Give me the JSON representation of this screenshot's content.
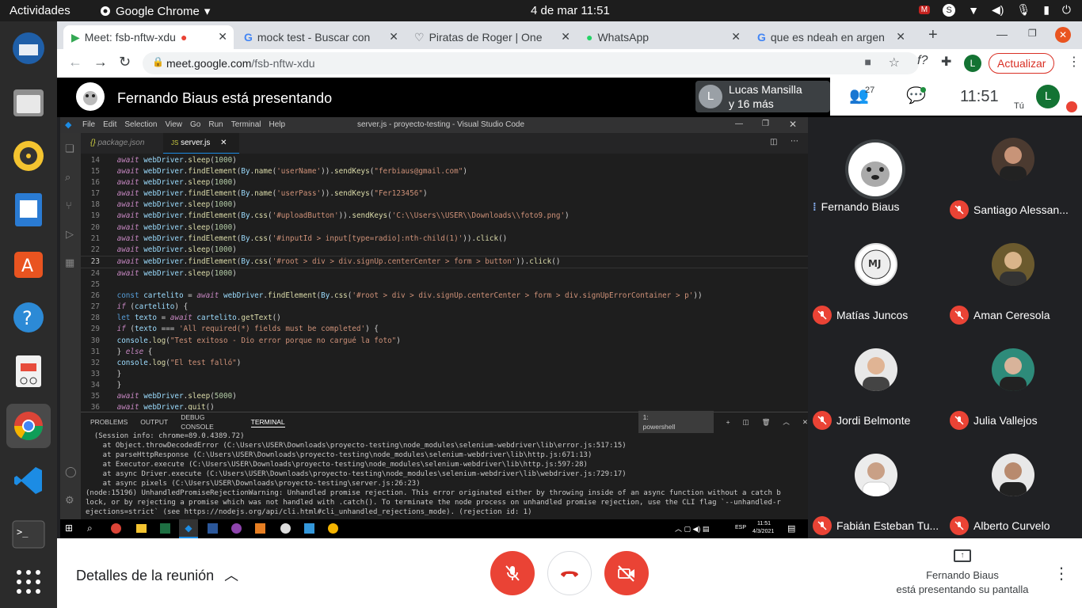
{
  "topbar": {
    "activities": "Actividades",
    "app_name": "Google Chrome",
    "clock": "4 de mar  11:51"
  },
  "browser": {
    "tabs": [
      {
        "label": "Meet: fsb-nftw-xdu"
      },
      {
        "label": "mock test - Buscar con"
      },
      {
        "label": "Piratas de Roger | One"
      },
      {
        "label": "WhatsApp"
      },
      {
        "label": "que es ndeah en argen"
      }
    ],
    "url_host": "meet.google.com",
    "url_path": "/fsb-nftw-xdu",
    "update_label": "Actualizar"
  },
  "meet": {
    "presenting_title": "Fernando Biaus está presentando",
    "guest_name": "Lucas Mansilla",
    "guest_more": "y 16 más",
    "people_count": "27",
    "time": "11:51",
    "you_label": "Tú",
    "self_initial": "L",
    "guest_initial": "L",
    "participants": [
      {
        "name": "Fernando Biaus",
        "muted": false
      },
      {
        "name": "Santiago Alessan...",
        "muted": true
      },
      {
        "name": "Matías Juncos",
        "muted": true
      },
      {
        "name": "Aman Ceresola",
        "muted": true
      },
      {
        "name": "Jordi Belmonte",
        "muted": true
      },
      {
        "name": "Julia Vallejos",
        "muted": true
      },
      {
        "name": "Fabián Esteban Tu...",
        "muted": true
      },
      {
        "name": "Alberto Curvelo",
        "muted": true
      }
    ],
    "details_label": "Detalles de la reunión",
    "presenter_line1": "Fernando Biaus",
    "presenter_line2": "está presentando su pantalla"
  },
  "vscode": {
    "menu": [
      "File",
      "Edit",
      "Selection",
      "View",
      "Go",
      "Run",
      "Terminal",
      "Help"
    ],
    "title": "server.js - proyecto-testing - Visual Studio Code",
    "tabs": [
      "package.json",
      "server.js"
    ],
    "code_lines": [
      {
        "n": "14",
        "t": "      await webDriver.sleep(1000)"
      },
      {
        "n": "15",
        "t": "      await webDriver.findElement(By.name('userName')).sendKeys(\"ferbiaus@gmail.com\")"
      },
      {
        "n": "16",
        "t": "      await webDriver.sleep(1000)"
      },
      {
        "n": "17",
        "t": "      await webDriver.findElement(By.name('userPass')).sendKeys(\"Fer123456\")"
      },
      {
        "n": "18",
        "t": "      await webDriver.sleep(1000)"
      },
      {
        "n": "19",
        "t": "      await webDriver.findElement(By.css('#uploadButton')).sendKeys('C:\\\\Users\\\\USER\\\\Downloads\\\\foto9.png')"
      },
      {
        "n": "20",
        "t": "      await webDriver.sleep(1000)"
      },
      {
        "n": "21",
        "t": "      await webDriver.findElement(By.css('#inputId > input[type=radio]:nth-child(1)')).click()"
      },
      {
        "n": "22",
        "t": "      await webDriver.sleep(1000)"
      },
      {
        "n": "23",
        "t": "      await webDriver.findElement(By.css('#root > div > div.signUp.centerCenter > form > button')).click()"
      },
      {
        "n": "24",
        "t": "      await webDriver.sleep(1000)"
      },
      {
        "n": "25",
        "t": ""
      },
      {
        "n": "26",
        "t": "      const cartelito = await webDriver.findElement(By.css('#root > div > div.signUp.centerCenter > form > div.signUpErrorContainer > p'))"
      },
      {
        "n": "27",
        "t": "      if (cartelito) {"
      },
      {
        "n": "28",
        "t": "          let texto = await cartelito.getText()"
      },
      {
        "n": "29",
        "t": "          if (texto === 'All required(*) fields must be completed') {"
      },
      {
        "n": "30",
        "t": "              console.log(\"Test exitoso - Dio error porque no cargué la foto\")"
      },
      {
        "n": "31",
        "t": "          } else {"
      },
      {
        "n": "32",
        "t": "              console.log(\"El test falló\")"
      },
      {
        "n": "33",
        "t": "          }"
      },
      {
        "n": "34",
        "t": "      }"
      },
      {
        "n": "35",
        "t": "      await webDriver.sleep(5000)"
      },
      {
        "n": "36",
        "t": "      await webDriver.quit()"
      }
    ],
    "terminal_tabs": [
      "PROBLEMS",
      "OUTPUT",
      "DEBUG CONSOLE",
      "TERMINAL"
    ],
    "terminal_select": "1: powershell",
    "terminal_lines": [
      "  (Session info: chrome=89.0.4389.72)",
      "    at Object.throwDecodedError (C:\\Users\\USER\\Downloads\\proyecto-testing\\node_modules\\selenium-webdriver\\lib\\error.js:517:15)",
      "    at parseHttpResponse (C:\\Users\\USER\\Downloads\\proyecto-testing\\node_modules\\selenium-webdriver\\lib\\http.js:671:13)",
      "    at Executor.execute (C:\\Users\\USER\\Downloads\\proyecto-testing\\node_modules\\selenium-webdriver\\lib\\http.js:597:28)",
      "    at async Driver.execute (C:\\Users\\USER\\Downloads\\proyecto-testing\\node_modules\\selenium-webdriver\\lib\\webdriver.js:729:17)",
      "    at async pixels (C:\\Users\\USER\\Downloads\\proyecto-testing\\server.js:26:23)",
      "(node:15196) UnhandledPromiseRejectionWarning: Unhandled promise rejection. This error originated either by throwing inside of an async function without a catch b",
      "lock, or by rejecting a promise which was not handled with .catch(). To terminate the node process on unhandled promise rejection, use the CLI flag `--unhandled-r",
      "ejections=strict` (see https://nodejs.org/api/cli.html#cli_unhandled_rejections_mode). (rejection id: 1)"
    ],
    "win_tray": {
      "lang": "ESP",
      "time": "11:51",
      "date": "4/3/2021"
    }
  }
}
